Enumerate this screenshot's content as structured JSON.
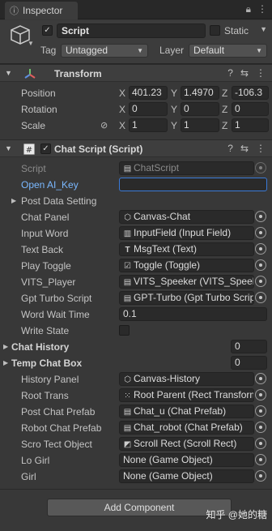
{
  "tab": {
    "label": "Inspector",
    "icon": "info-icon"
  },
  "object": {
    "name": "Script",
    "active": true,
    "static_label": "Static",
    "tag_label": "Tag",
    "tag_value": "Untagged",
    "layer_label": "Layer",
    "layer_value": "Default"
  },
  "transform": {
    "title": "Transform",
    "position": {
      "label": "Position",
      "x": "401.23",
      "y": "1.4970",
      "z": "-106.3"
    },
    "rotation": {
      "label": "Rotation",
      "x": "0",
      "y": "0",
      "z": "0"
    },
    "scale": {
      "label": "Scale",
      "x": "1",
      "y": "1",
      "z": "1"
    },
    "axes": {
      "x": "X",
      "y": "Y",
      "z": "Z"
    }
  },
  "chat_script": {
    "title": "Chat Script (Script)",
    "rows": {
      "script": {
        "label": "Script",
        "value": "ChatScript"
      },
      "openai_key": {
        "label": "Open AI_Key",
        "value": ""
      },
      "post_data": {
        "label": "Post Data Setting"
      },
      "chat_panel": {
        "label": "Chat Panel",
        "value": "Canvas-Chat"
      },
      "input_word": {
        "label": "Input Word",
        "value": "InputField (Input Field)"
      },
      "text_back": {
        "label": "Text Back",
        "value": "MsgText (Text)"
      },
      "play_toggle": {
        "label": "Play Toggle",
        "value": "Toggle (Toggle)"
      },
      "vits_player": {
        "label": "VITS_Player",
        "value": "VITS_Speeker (VITS_Speeker)"
      },
      "gpt_turbo": {
        "label": "Gpt Turbo Script",
        "value": "GPT-Turbo (Gpt Turbo Script)"
      },
      "word_wait": {
        "label": "Word Wait Time",
        "value": "0.1"
      },
      "write_state": {
        "label": "Write State"
      },
      "chat_history": {
        "label": "Chat History",
        "value": "0"
      },
      "temp_chat_box": {
        "label": "Temp Chat Box",
        "value": "0"
      },
      "history_panel": {
        "label": "History Panel",
        "value": "Canvas-History"
      },
      "root_trans": {
        "label": "Root Trans",
        "value": "Root Parent (Rect Transform)"
      },
      "post_chat_prefab": {
        "label": "Post Chat Prefab",
        "value": "Chat_u (Chat Prefab)"
      },
      "robot_chat_prefab": {
        "label": "Robot Chat Prefab",
        "value": "Chat_robot (Chat Prefab)"
      },
      "scroll_rect": {
        "label": "Scro Tect Object",
        "value": "Scroll Rect (Scroll Rect)"
      },
      "lo_girl": {
        "label": "Lo Girl",
        "value": "None (Game Object)"
      },
      "girl": {
        "label": "Girl",
        "value": "None (Game Object)"
      }
    }
  },
  "add_component_label": "Add Component",
  "watermark": "知乎 @她的糖",
  "colors": {
    "panel": "#383838",
    "header": "#3e3e3e",
    "field": "#2a2a2a",
    "link": "#7ab8ff",
    "focus": "#3a7ad8"
  }
}
